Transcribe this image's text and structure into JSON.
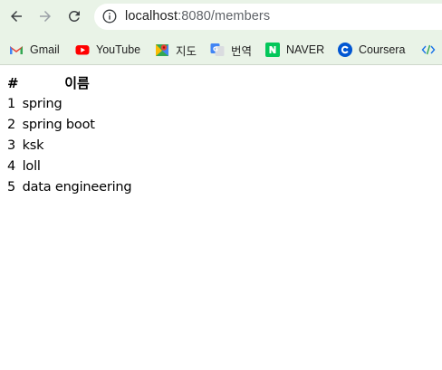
{
  "browser": {
    "url_host": "localhost",
    "url_rest": ":8080/members",
    "bookmarks": [
      {
        "label": "Gmail",
        "icon": "gmail-icon"
      },
      {
        "label": "YouTube",
        "icon": "youtube-icon"
      },
      {
        "label": "지도",
        "icon": "maps-icon"
      },
      {
        "label": "번역",
        "icon": "translate-icon"
      },
      {
        "label": "NAVER",
        "icon": "naver-icon"
      },
      {
        "label": "Coursera",
        "icon": "coursera-icon"
      }
    ]
  },
  "table": {
    "headers": [
      "#",
      "이름"
    ],
    "rows": [
      {
        "id": "1",
        "name": "spring"
      },
      {
        "id": "2",
        "name": "spring boot"
      },
      {
        "id": "3",
        "name": "ksk"
      },
      {
        "id": "4",
        "name": "loll"
      },
      {
        "id": "5",
        "name": "data engineering"
      }
    ]
  },
  "colors": {
    "toolbar_bg": "#e9f3e7",
    "gmail_red": "#ea4335",
    "youtube_red": "#ff0000",
    "naver_green": "#03c75a",
    "coursera_blue": "#0056d2"
  }
}
